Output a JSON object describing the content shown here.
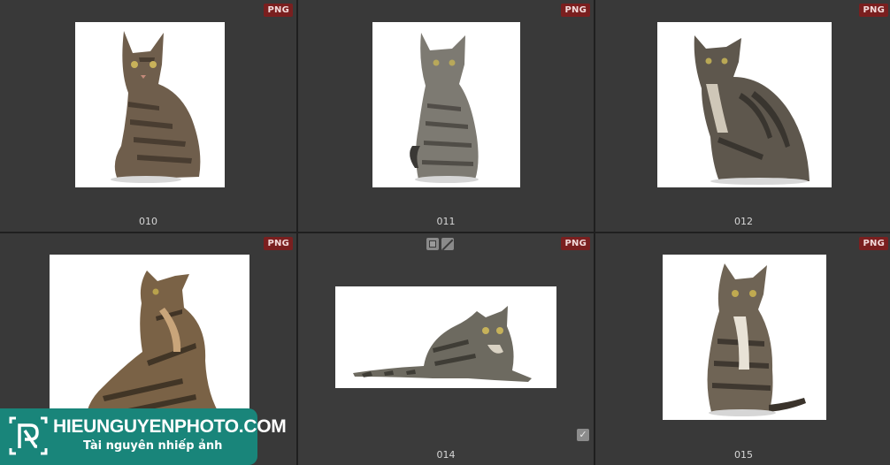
{
  "gallery": {
    "items": [
      {
        "name": "010",
        "format": "PNG",
        "image": "tabby-kitten-sitting-front"
      },
      {
        "name": "011",
        "format": "PNG",
        "image": "grey-tabby-cat-sitting"
      },
      {
        "name": "012",
        "format": "PNG",
        "image": "tabby-cat-sitting-side"
      },
      {
        "name": "",
        "format": "PNG",
        "image": "tabby-cat-sitting-looking-up"
      },
      {
        "name": "014",
        "format": "PNG",
        "image": "tabby-cat-crouching",
        "selected": true
      },
      {
        "name": "015",
        "format": "PNG",
        "image": "tabby-cat-sitting-front"
      }
    ],
    "cell_icons": [
      "transparency-square-icon",
      "slash-icon",
      "checkmark-icon"
    ]
  },
  "watermark": {
    "title": "HIEUNGUYENPHOTO.COM",
    "subtitle": "Tài nguyên nhiếp ảnh",
    "brand_color": "#19857a"
  },
  "colors": {
    "cell_bg": "#393939",
    "badge_bg": "#7a1f1f",
    "thumb_bg": "#ffffff"
  }
}
